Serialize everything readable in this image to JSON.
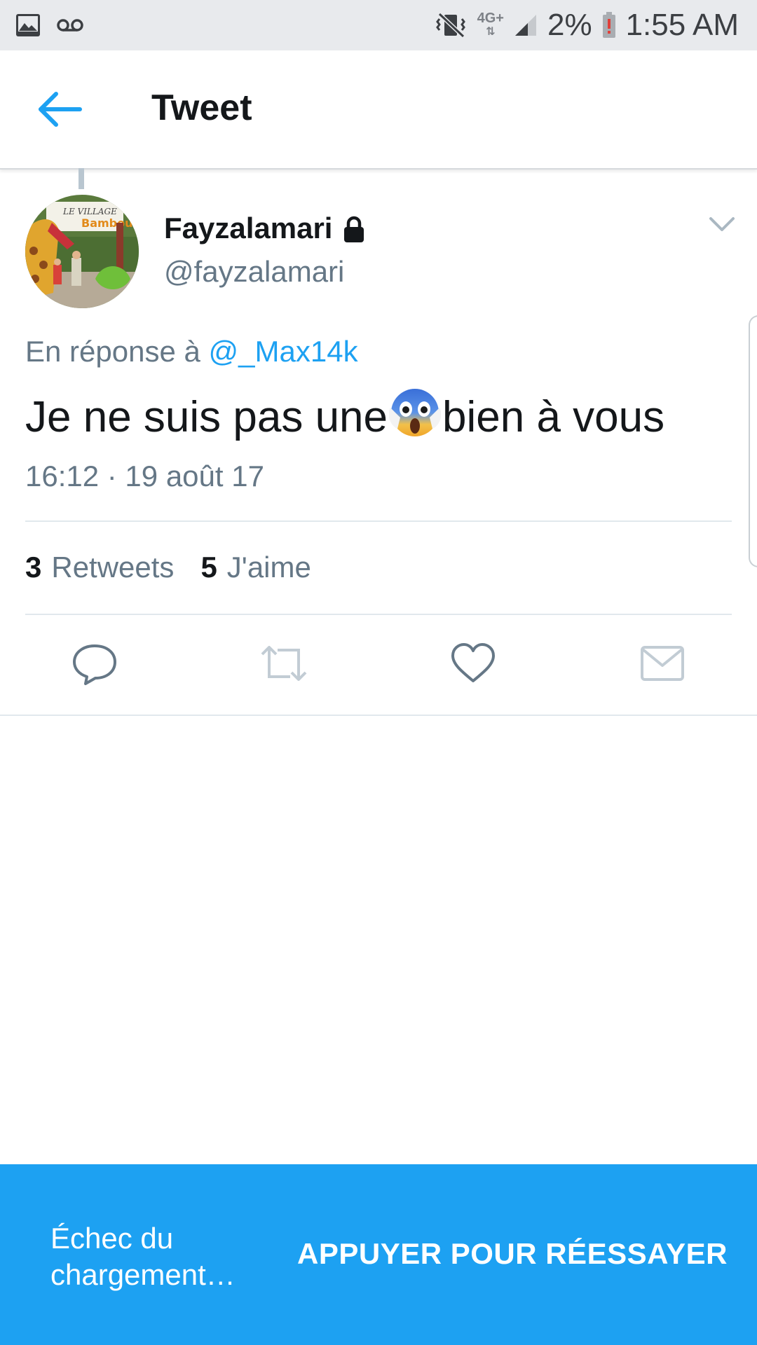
{
  "status_bar": {
    "network": "4G+",
    "battery": "2%",
    "time": "1:55 AM",
    "icons": [
      "image-icon",
      "voicemail-icon",
      "vibrate-icon",
      "signal-icon",
      "battery-low-icon"
    ]
  },
  "header": {
    "back_icon": "arrow-left-icon",
    "title": "Tweet"
  },
  "tweet": {
    "display_name": "Fayzalamari",
    "handle": "@fayzalamari",
    "reply_prefix": "En réponse à ",
    "reply_to": "@_Max14k",
    "text_before": "Je ne suis pas une",
    "text_after": "bien à vous",
    "emoji": "face-screaming-in-fear",
    "timestamp": "16:12 · 19 août 17",
    "retweets_count": "3",
    "retweets_label": "Retweets",
    "likes_count": "5",
    "likes_label": "J'aime",
    "accent": "#1da1f2"
  },
  "actions": [
    "reply-icon",
    "retweet-icon",
    "like-icon",
    "direct-message-icon"
  ],
  "bottom_bar": {
    "error_text": "Échec du chargement…",
    "retry_label": "APPUYER POUR RÉESSAYER",
    "color": "#1da1f2"
  }
}
